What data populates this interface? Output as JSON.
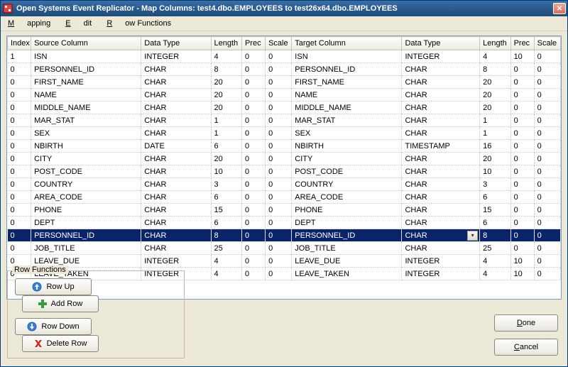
{
  "window": {
    "title": "Open Systems Event Replicator - Map Columns:  test4.dbo.EMPLOYEES  to  test26x64.dbo.EMPLOYEES"
  },
  "menu": {
    "mapping": "Mapping",
    "edit": "Edit",
    "row_functions": "Row Functions"
  },
  "grid": {
    "headers": {
      "index": "Index",
      "source_column": "Source Column",
      "src_data_type": "Data Type",
      "src_length": "Length",
      "src_prec": "Prec",
      "src_scale": "Scale",
      "target_column": "Target Column",
      "tgt_data_type": "Data Type",
      "tgt_length": "Length",
      "tgt_prec": "Prec",
      "tgt_scale": "Scale"
    },
    "selected_index": 13,
    "rows": [
      {
        "index": "1",
        "src_col": "ISN",
        "src_type": "INTEGER",
        "src_len": "4",
        "src_prec": "0",
        "src_scale": "0",
        "tgt_col": "ISN",
        "tgt_type": "INTEGER",
        "tgt_len": "4",
        "tgt_prec": "10",
        "tgt_scale": "0"
      },
      {
        "index": "0",
        "src_col": "PERSONNEL_ID",
        "src_type": "CHAR",
        "src_len": "8",
        "src_prec": "0",
        "src_scale": "0",
        "tgt_col": "PERSONNEL_ID",
        "tgt_type": "CHAR",
        "tgt_len": "8",
        "tgt_prec": "0",
        "tgt_scale": "0"
      },
      {
        "index": "0",
        "src_col": "FIRST_NAME",
        "src_type": "CHAR",
        "src_len": "20",
        "src_prec": "0",
        "src_scale": "0",
        "tgt_col": "FIRST_NAME",
        "tgt_type": "CHAR",
        "tgt_len": "20",
        "tgt_prec": "0",
        "tgt_scale": "0"
      },
      {
        "index": "0",
        "src_col": "NAME",
        "src_type": "CHAR",
        "src_len": "20",
        "src_prec": "0",
        "src_scale": "0",
        "tgt_col": "NAME",
        "tgt_type": "CHAR",
        "tgt_len": "20",
        "tgt_prec": "0",
        "tgt_scale": "0"
      },
      {
        "index": "0",
        "src_col": "MIDDLE_NAME",
        "src_type": "CHAR",
        "src_len": "20",
        "src_prec": "0",
        "src_scale": "0",
        "tgt_col": "MIDDLE_NAME",
        "tgt_type": "CHAR",
        "tgt_len": "20",
        "tgt_prec": "0",
        "tgt_scale": "0"
      },
      {
        "index": "0",
        "src_col": "MAR_STAT",
        "src_type": "CHAR",
        "src_len": "1",
        "src_prec": "0",
        "src_scale": "0",
        "tgt_col": "MAR_STAT",
        "tgt_type": "CHAR",
        "tgt_len": "1",
        "tgt_prec": "0",
        "tgt_scale": "0"
      },
      {
        "index": "0",
        "src_col": "SEX",
        "src_type": "CHAR",
        "src_len": "1",
        "src_prec": "0",
        "src_scale": "0",
        "tgt_col": "SEX",
        "tgt_type": "CHAR",
        "tgt_len": "1",
        "tgt_prec": "0",
        "tgt_scale": "0"
      },
      {
        "index": "0",
        "src_col": "NBIRTH",
        "src_type": "DATE",
        "src_len": "6",
        "src_prec": "0",
        "src_scale": "0",
        "tgt_col": "NBIRTH",
        "tgt_type": "TIMESTAMP",
        "tgt_len": "16",
        "tgt_prec": "0",
        "tgt_scale": "0"
      },
      {
        "index": "0",
        "src_col": "CITY",
        "src_type": "CHAR",
        "src_len": "20",
        "src_prec": "0",
        "src_scale": "0",
        "tgt_col": "CITY",
        "tgt_type": "CHAR",
        "tgt_len": "20",
        "tgt_prec": "0",
        "tgt_scale": "0"
      },
      {
        "index": "0",
        "src_col": "POST_CODE",
        "src_type": "CHAR",
        "src_len": "10",
        "src_prec": "0",
        "src_scale": "0",
        "tgt_col": "POST_CODE",
        "tgt_type": "CHAR",
        "tgt_len": "10",
        "tgt_prec": "0",
        "tgt_scale": "0"
      },
      {
        "index": "0",
        "src_col": "COUNTRY",
        "src_type": "CHAR",
        "src_len": "3",
        "src_prec": "0",
        "src_scale": "0",
        "tgt_col": "COUNTRY",
        "tgt_type": "CHAR",
        "tgt_len": "3",
        "tgt_prec": "0",
        "tgt_scale": "0"
      },
      {
        "index": "0",
        "src_col": "AREA_CODE",
        "src_type": "CHAR",
        "src_len": "6",
        "src_prec": "0",
        "src_scale": "0",
        "tgt_col": "AREA_CODE",
        "tgt_type": "CHAR",
        "tgt_len": "6",
        "tgt_prec": "0",
        "tgt_scale": "0"
      },
      {
        "index": "0",
        "src_col": "PHONE",
        "src_type": "CHAR",
        "src_len": "15",
        "src_prec": "0",
        "src_scale": "0",
        "tgt_col": "PHONE",
        "tgt_type": "CHAR",
        "tgt_len": "15",
        "tgt_prec": "0",
        "tgt_scale": "0"
      },
      {
        "index": "0",
        "src_col": "DEPT",
        "src_type": "CHAR",
        "src_len": "6",
        "src_prec": "0",
        "src_scale": "0",
        "tgt_col": "DEPT",
        "tgt_type": "CHAR",
        "tgt_len": "6",
        "tgt_prec": "0",
        "tgt_scale": "0"
      },
      {
        "index": "0",
        "src_col": "PERSONNEL_ID",
        "src_type": "CHAR",
        "src_len": "8",
        "src_prec": "0",
        "src_scale": "0",
        "tgt_col": "PERSONNEL_ID",
        "tgt_type": "CHAR",
        "tgt_len": "8",
        "tgt_prec": "0",
        "tgt_scale": "0",
        "selected": true,
        "dropdown": true
      },
      {
        "index": "0",
        "src_col": "JOB_TITLE",
        "src_type": "CHAR",
        "src_len": "25",
        "src_prec": "0",
        "src_scale": "0",
        "tgt_col": "JOB_TITLE",
        "tgt_type": "CHAR",
        "tgt_len": "25",
        "tgt_prec": "0",
        "tgt_scale": "0"
      },
      {
        "index": "0",
        "src_col": "LEAVE_DUE",
        "src_type": "INTEGER",
        "src_len": "4",
        "src_prec": "0",
        "src_scale": "0",
        "tgt_col": "LEAVE_DUE",
        "tgt_type": "INTEGER",
        "tgt_len": "4",
        "tgt_prec": "10",
        "tgt_scale": "0"
      },
      {
        "index": "0",
        "src_col": "LEAVE_TAKEN",
        "src_type": "INTEGER",
        "src_len": "4",
        "src_prec": "0",
        "src_scale": "0",
        "tgt_col": "LEAVE_TAKEN",
        "tgt_type": "INTEGER",
        "tgt_len": "4",
        "tgt_prec": "10",
        "tgt_scale": "0"
      }
    ]
  },
  "row_functions": {
    "legend": "Row Functions",
    "row_up": "Row Up",
    "row_down": "Row Down",
    "add_row": "Add Row",
    "delete_row": "Delete Row"
  },
  "buttons": {
    "done": "Done",
    "cancel": "Cancel"
  }
}
